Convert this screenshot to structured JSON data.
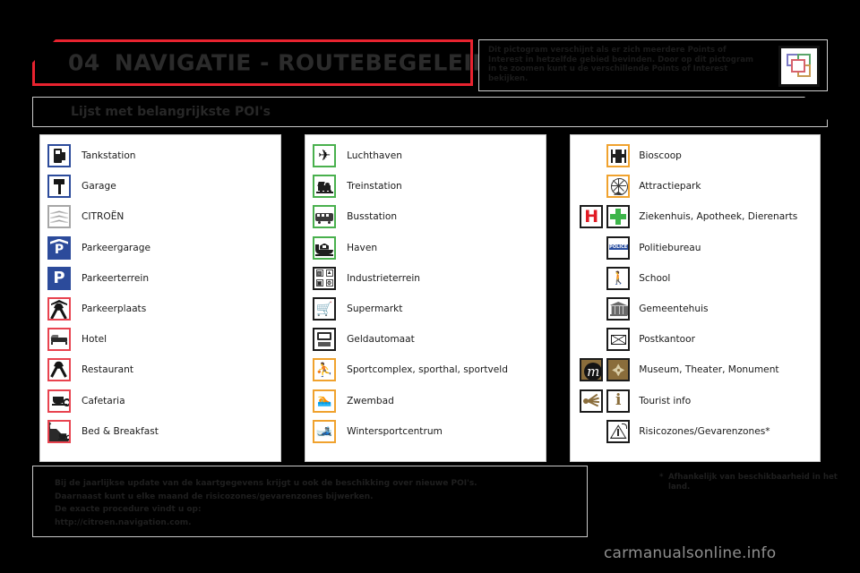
{
  "chapter": {
    "number": "04",
    "title": "NAVIGATIE - ROUTEBEGELEIDING"
  },
  "top_note": {
    "text": "Dit pictogram verschijnt als er zich meerdere Points of Interest in hetzelfde gebied bevinden. Door op dit pictogram in te zoomen kunt u de verschillende Points of Interest bekijken.",
    "icon_name": "multiple-poi-pictogram"
  },
  "section": {
    "title": "Lijst met belangrijkste POI's"
  },
  "columns": [
    {
      "id": "column-1",
      "items": [
        {
          "label": "Tankstation",
          "icon": "fuel-pump-icon"
        },
        {
          "label": "Garage",
          "icon": "wrench-icon"
        },
        {
          "label": "CITROËN",
          "icon": "citroen-chevrons-icon"
        },
        {
          "label": "Parkeergarage",
          "icon": "parking-garage-icon"
        },
        {
          "label": "Parkeerterrein",
          "icon": "parking-lot-icon"
        },
        {
          "label": "Parkeerplaats",
          "icon": "rest-area-icon"
        },
        {
          "label": "Hotel",
          "icon": "hotel-bed-icon"
        },
        {
          "label": "Restaurant",
          "icon": "restaurant-cutlery-icon"
        },
        {
          "label": "Cafetaria",
          "icon": "coffee-cup-icon"
        },
        {
          "label": "Bed & Breakfast",
          "icon": "bed-and-breakfast-icon"
        }
      ]
    },
    {
      "id": "column-2",
      "items": [
        {
          "label": "Luchthaven",
          "icon": "airplane-icon"
        },
        {
          "label": "Treinstation",
          "icon": "train-icon"
        },
        {
          "label": "Busstation",
          "icon": "bus-icon"
        },
        {
          "label": "Haven",
          "icon": "harbour-icon"
        },
        {
          "label": "Industrieterrein",
          "icon": "industrial-estate-icon"
        },
        {
          "label": "Supermarkt",
          "icon": "shopping-cart-icon"
        },
        {
          "label": "Geldautomaat",
          "icon": "atm-icon"
        },
        {
          "label": "Sportcomplex, sporthal, sportveld",
          "icon": "sports-complex-icon"
        },
        {
          "label": "Zwembad",
          "icon": "swimming-pool-icon"
        },
        {
          "label": "Wintersportcentrum",
          "icon": "winter-sports-icon"
        }
      ]
    },
    {
      "id": "column-3",
      "items": [
        {
          "label": "Bioscoop",
          "icon": "cinema-icon"
        },
        {
          "label": "Attractiepark",
          "icon": "amusement-park-icon"
        },
        {
          "label": "Ziekenhuis, Apotheek, Dierenarts",
          "icon": "hospital-h-icon",
          "icon2": "pharmacy-cross-icon"
        },
        {
          "label": "Politiebureau",
          "icon": "police-station-icon"
        },
        {
          "label": "School",
          "icon": "school-icon"
        },
        {
          "label": "Gemeentehuis",
          "icon": "town-hall-icon"
        },
        {
          "label": "Postkantoor",
          "icon": "post-office-icon"
        },
        {
          "label": "Museum, Theater, Monument",
          "icon": "museum-m-icon",
          "icon2": "monument-icon"
        },
        {
          "label": "Tourist info",
          "icon": "tourist-beacon-icon",
          "icon2": "information-i-icon"
        },
        {
          "label": "Risicozones/Gevarenzones*",
          "icon": "hazard-zone-icon"
        }
      ]
    }
  ],
  "bottom_note": {
    "lines": [
      "Bij de jaarlijkse update van de kaartgegevens krijgt u ook de beschikking over nieuwe POI's.",
      "Daarnaast kunt u elke maand de risicozones/gevarenzones bijwerken.",
      "De exacte procedure vindt u op:",
      "http://citroen.navigation.com."
    ]
  },
  "footnote": {
    "marker": "*",
    "text": "Afhankelijk van beschikbaarheid in het land."
  },
  "watermark": "carmanualsonline.info",
  "colors": {
    "accent_red": "#e8232f",
    "border_blue": "#2c4b9b",
    "border_green": "#49b04d",
    "border_orange": "#f0a22e",
    "border_red": "#e8434f",
    "border_grey": "#a6a6a6",
    "border_dark": "#1b1b1b"
  }
}
